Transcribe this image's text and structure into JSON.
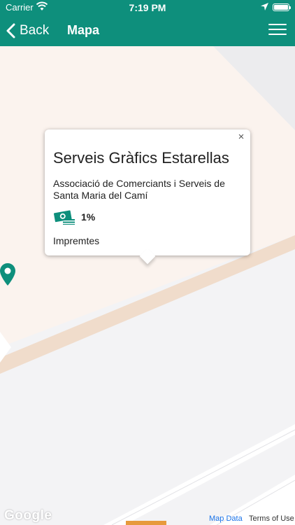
{
  "status_bar": {
    "carrier": "Carrier",
    "time": "7:19 PM"
  },
  "nav": {
    "back_label": "Back",
    "title": "Mapa"
  },
  "popup": {
    "title": "Serveis Gràfics Estarellas",
    "association": "Associació de Comerciants i Serveis de Santa Maria del Camí",
    "discount": "1%",
    "category": "Impremtes",
    "close": "×"
  },
  "map": {
    "attribution_logo": "Google",
    "map_data_link": "Map Data",
    "terms_link": "Terms of Use"
  },
  "colors": {
    "brand": "#0e8f7c",
    "marker": "#0e8f7c"
  }
}
